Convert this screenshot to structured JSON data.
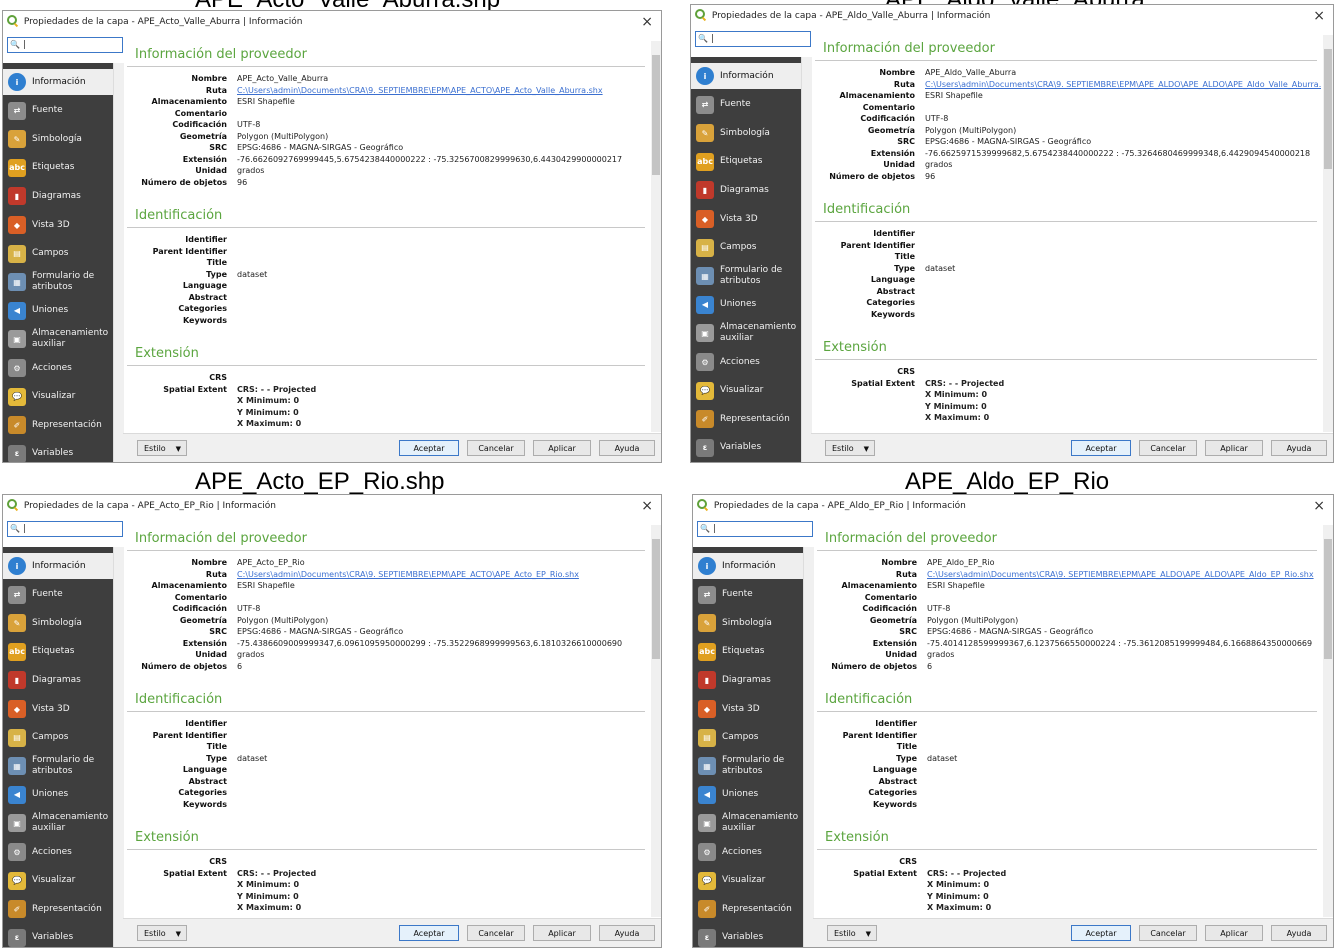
{
  "captions": [
    "APE_Acto_Valle_Aburra.shp",
    "APE_Aldo_Valle_Aburra",
    "APE_Acto_EP_Rio.shp",
    "APE_Aldo_EP_Rio"
  ],
  "icons": {
    "informacion": "info-icon",
    "fuente": "source-icon",
    "simbologia": "brush-icon",
    "etiquetas": "labels-icon",
    "diagramas": "diagram-icon",
    "vista3d": "cube-icon",
    "campos": "fields-icon",
    "formulario": "form-icon",
    "uniones": "join-icon",
    "almacenamiento": "storage-icon",
    "acciones": "gear-icon",
    "visualizar": "chat-icon",
    "representacion": "render-icon",
    "variables": "variables-icon"
  },
  "sidebar_labels": [
    "Información",
    "Fuente",
    "Simbología",
    "Etiquetas",
    "Diagramas",
    "Vista 3D",
    "Campos",
    "Formulario de atributos",
    "Uniones",
    "Almacenamiento auxiliar",
    "Acciones",
    "Visualizar",
    "Representación",
    "Variables"
  ],
  "labels": {
    "provider_heading": "Información del proveedor",
    "ident_heading": "Identificación",
    "extent_heading": "Extensión",
    "k_nombre": "Nombre",
    "k_ruta": "Ruta",
    "k_almac": "Almacenamiento",
    "k_coment": "Comentario",
    "k_codif": "Codificación",
    "k_geom": "Geometría",
    "k_src": "SRC",
    "k_ext": "Extensión",
    "k_unidad": "Unidad",
    "k_nobj": "Número de objetos",
    "k_identifier": "Identifier",
    "k_parent": "Parent Identifier",
    "k_title": "Title",
    "k_type": "Type",
    "k_language": "Language",
    "k_abstract": "Abstract",
    "k_categories": "Categories",
    "k_keywords": "Keywords",
    "k_crs": "CRS",
    "k_spatial": "Spatial Extent",
    "crs_projected": "CRS: - - Projected",
    "xmin": "X Minimum: 0",
    "ymin": "Y Minimum: 0",
    "xmax": "X Maximum: 0",
    "type_value": "dataset",
    "estilo": "Estilo",
    "aceptar": "Aceptar",
    "cancelar": "Cancelar",
    "aplicar": "Aplicar",
    "ayuda": "Ayuda",
    "close": "×",
    "search_glyph": "🔍"
  },
  "dialogs": [
    {
      "title": "Propiedades de la capa - APE_Acto_Valle_Aburra | Información",
      "nombre": "APE_Acto_Valle_Aburra",
      "ruta": "C:\\Users\\admin\\Documents\\CRA\\9. SEPTIEMBRE\\EPM\\APE_ACTO\\APE_Acto_Valle_Aburra.shx",
      "almacenamiento": "ESRI Shapefile",
      "codificacion": "UTF-8",
      "geometria": "Polygon (MultiPolygon)",
      "src": "EPSG:4686 - MAGNA-SIRGAS - Geográfico",
      "extension": "-76.6626092769999445,5.6754238440000222 : -75.3256700829999630,6.4430429900000217",
      "unidad": "grados",
      "num_objetos": "96"
    },
    {
      "title": "Propiedades de la capa - APE_Aldo_Valle_Aburra | Información",
      "nombre": "APE_Aldo_Valle_Aburra",
      "ruta": "C:\\Users\\admin\\Documents\\CRA\\9. SEPTIEMBRE\\EPM\\APE_ALDO\\APE_ALDO\\APE_Aldo_Valle_Aburra.shx",
      "almacenamiento": "ESRI Shapefile",
      "codificacion": "UTF-8",
      "geometria": "Polygon (MultiPolygon)",
      "src": "EPSG:4686 - MAGNA-SIRGAS - Geográfico",
      "extension": "-76.6625971539999682,5.6754238440000222 : -75.3264680469999348,6.4429094540000218",
      "unidad": "grados",
      "num_objetos": "96"
    },
    {
      "title": "Propiedades de la capa - APE_Acto_EP_Rio | Información",
      "nombre": "APE_Acto_EP_Rio",
      "ruta": "C:\\Users\\admin\\Documents\\CRA\\9. SEPTIEMBRE\\EPM\\APE_ACTO\\APE_Acto_EP_Rio.shx",
      "almacenamiento": "ESRI Shapefile",
      "codificacion": "UTF-8",
      "geometria": "Polygon (MultiPolygon)",
      "src": "EPSG:4686 - MAGNA-SIRGAS - Geográfico",
      "extension": "-75.4386609009999347,6.0961095950000299 : -75.3522968999999563,6.1810326610000690",
      "unidad": "grados",
      "num_objetos": "6"
    },
    {
      "title": "Propiedades de la capa - APE_Aldo_EP_Rio | Información",
      "nombre": "APE_Aldo_EP_Rio",
      "ruta": "C:\\Users\\admin\\Documents\\CRA\\9. SEPTIEMBRE\\EPM\\APE_ALDO\\APE_ALDO\\APE_Aldo_EP_Rio.shx",
      "almacenamiento": "ESRI Shapefile",
      "codificacion": "UTF-8",
      "geometria": "Polygon (MultiPolygon)",
      "src": "EPSG:4686 - MAGNA-SIRGAS - Geográfico",
      "extension": "-75.4014128599999367,6.1237566550000224 : -75.3612085199999484,6.1668864350000669",
      "unidad": "grados",
      "num_objetos": "6"
    }
  ],
  "colors": {
    "accent_green": "#5ba53f",
    "sidebar_bg": "#3e3e3e",
    "link_blue": "#3b6fd0",
    "focus_blue": "#3c78c8"
  }
}
